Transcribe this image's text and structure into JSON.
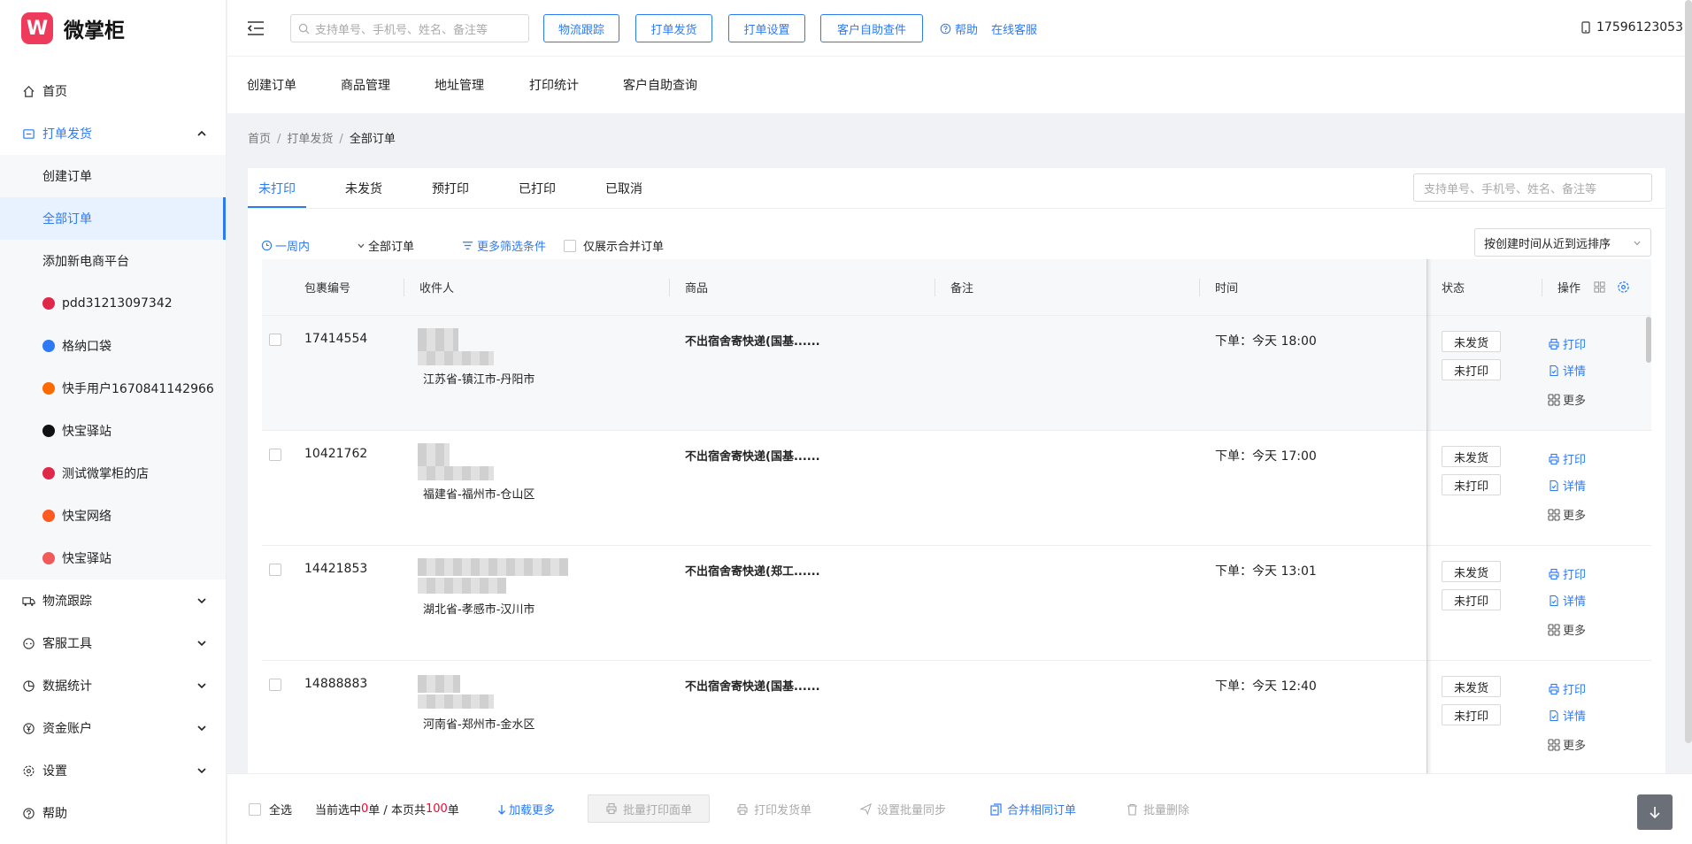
{
  "app": {
    "logo_glyph": "W",
    "name": "微掌柜",
    "accent": "#2d7bf4",
    "logo_color": "#ef3b5b"
  },
  "sidebar": {
    "home": "首页",
    "print_ship": "打单发货",
    "sub": [
      "创建订单",
      "全部订单",
      "添加新电商平台"
    ],
    "shops": [
      {
        "name": "pdd31213097342",
        "color": "#e0284b"
      },
      {
        "name": "格纳口袋",
        "color": "#2d7bf4"
      },
      {
        "name": "快手用户1670841142966",
        "color": "#ff6a00"
      },
      {
        "name": "快宝驿站",
        "color": "#111111"
      },
      {
        "name": "测试微掌柜的店",
        "color": "#e0284b"
      },
      {
        "name": "快宝网络",
        "color": "#ff5a1f"
      },
      {
        "name": "快宝驿站",
        "color": "#f05a5a"
      }
    ],
    "groups": [
      "物流跟踪",
      "客服工具",
      "数据统计",
      "资金账户",
      "设置",
      "帮助"
    ]
  },
  "topbar": {
    "search_placeholder": "支持单号、手机号、姓名、备注等",
    "buttons": [
      "物流跟踪",
      "打单发货",
      "打单设置",
      "客户自助查件"
    ],
    "help": "帮助",
    "online_service": "在线客服",
    "phone": "17596123053"
  },
  "nav": [
    "创建订单",
    "商品管理",
    "地址管理",
    "打印统计",
    "客户自助查询"
  ],
  "breadcrumb": [
    "首页",
    "打单发货",
    "全部订单"
  ],
  "tabs": [
    "未打印",
    "未发货",
    "预打印",
    "已打印",
    "已取消"
  ],
  "tab_search_placeholder": "支持单号、手机号、姓名、备注等",
  "filters": {
    "period": "一周内",
    "all_orders": "全部订单",
    "more": "更多筛选条件",
    "merged_only": "仅展示合并订单"
  },
  "sort": "按创建时间从近到远排序",
  "columns": [
    "包裹编号",
    "收件人",
    "商品",
    "备注",
    "时间",
    "状态",
    "操作"
  ],
  "rows": [
    {
      "id": "17414554",
      "address": "江苏省-镇江市-丹阳市",
      "goods": "不出宿舍寄快递(国基......",
      "remark": "",
      "time": "下单：今天 18:00",
      "status": [
        "未发货",
        "未打印"
      ]
    },
    {
      "id": "10421762",
      "address": "福建省-福州市-仓山区",
      "goods": "不出宿舍寄快递(国基......",
      "remark": "",
      "time": "下单：今天 17:00",
      "status": [
        "未发货",
        "未打印"
      ]
    },
    {
      "id": "14421853",
      "address": "湖北省-孝感市-汉川市",
      "goods": "不出宿舍寄快递(郑工......",
      "remark": "",
      "time": "下单：今天 13:01",
      "status": [
        "未发货",
        "未打印"
      ]
    },
    {
      "id": "14888883",
      "address": "河南省-郑州市-金水区",
      "goods": "不出宿舍寄快递(国基......",
      "remark": "",
      "time": "下单：今天 12:40",
      "status": [
        "未发货",
        "未打印"
      ]
    }
  ],
  "ops": {
    "print": "打印",
    "detail": "详情",
    "more": "更多"
  },
  "footer": {
    "select_all": "全选",
    "selected_prefix": "当前选中",
    "selected_count": "0",
    "selected_mid": "单 / 本页共",
    "page_total": "100",
    "unit": "单",
    "load_more": "加载更多",
    "batch_print_waybill": "批量打印面单",
    "print_ship_doc": "打印发货单",
    "batch_sync": "设置批量同步",
    "merge_same": "合并相同订单",
    "batch_delete": "批量删除"
  }
}
